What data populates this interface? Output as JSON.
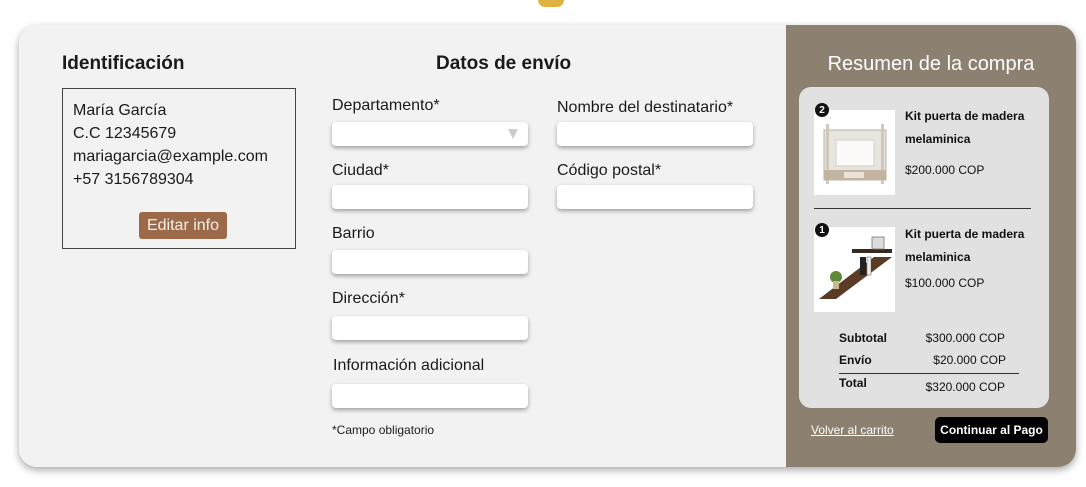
{
  "identification": {
    "title": "Identificación",
    "name": "María García",
    "document": "C.C 12345679",
    "email": "mariagarcia@example.com",
    "phone": "+57 3156789304",
    "edit_label": "Editar info"
  },
  "shipping": {
    "title": "Datos de envío",
    "department": {
      "label": "Departamento*",
      "value": ""
    },
    "recipient": {
      "label": "Nombre del destinatario*",
      "value": ""
    },
    "city": {
      "label": "Ciudad*",
      "value": ""
    },
    "postal_code": {
      "label": "Código postal*",
      "value": ""
    },
    "neighborhood": {
      "label": "Barrio",
      "value": ""
    },
    "address": {
      "label": "Dirección*",
      "value": ""
    },
    "additional": {
      "label": "Información adicional",
      "value": ""
    },
    "required_note": "*Campo obligatorio"
  },
  "summary": {
    "title": "Resumen de la compra",
    "items": [
      {
        "quantity": "2",
        "name": "Kit puerta de madera melaminica",
        "price": "$200.000 COP",
        "image": "tv-stand-furniture"
      },
      {
        "quantity": "1",
        "name": "Kit puerta de madera melaminica",
        "price": "$100.000 COP",
        "image": "wall-shelf-furniture"
      }
    ],
    "subtotal_label": "Subtotal",
    "subtotal_value": "$300.000 COP",
    "shipping_label": "Envío",
    "shipping_value": "$20.000 COP",
    "total_label": "Total",
    "total_value": "$320.000 COP",
    "back_label": "Volver al carrito",
    "continue_label": "Continuar al Pago"
  },
  "colors": {
    "summary_bg": "#8c8170",
    "edit_button": "#9c6a48",
    "accent_marker": "#e0b340"
  }
}
